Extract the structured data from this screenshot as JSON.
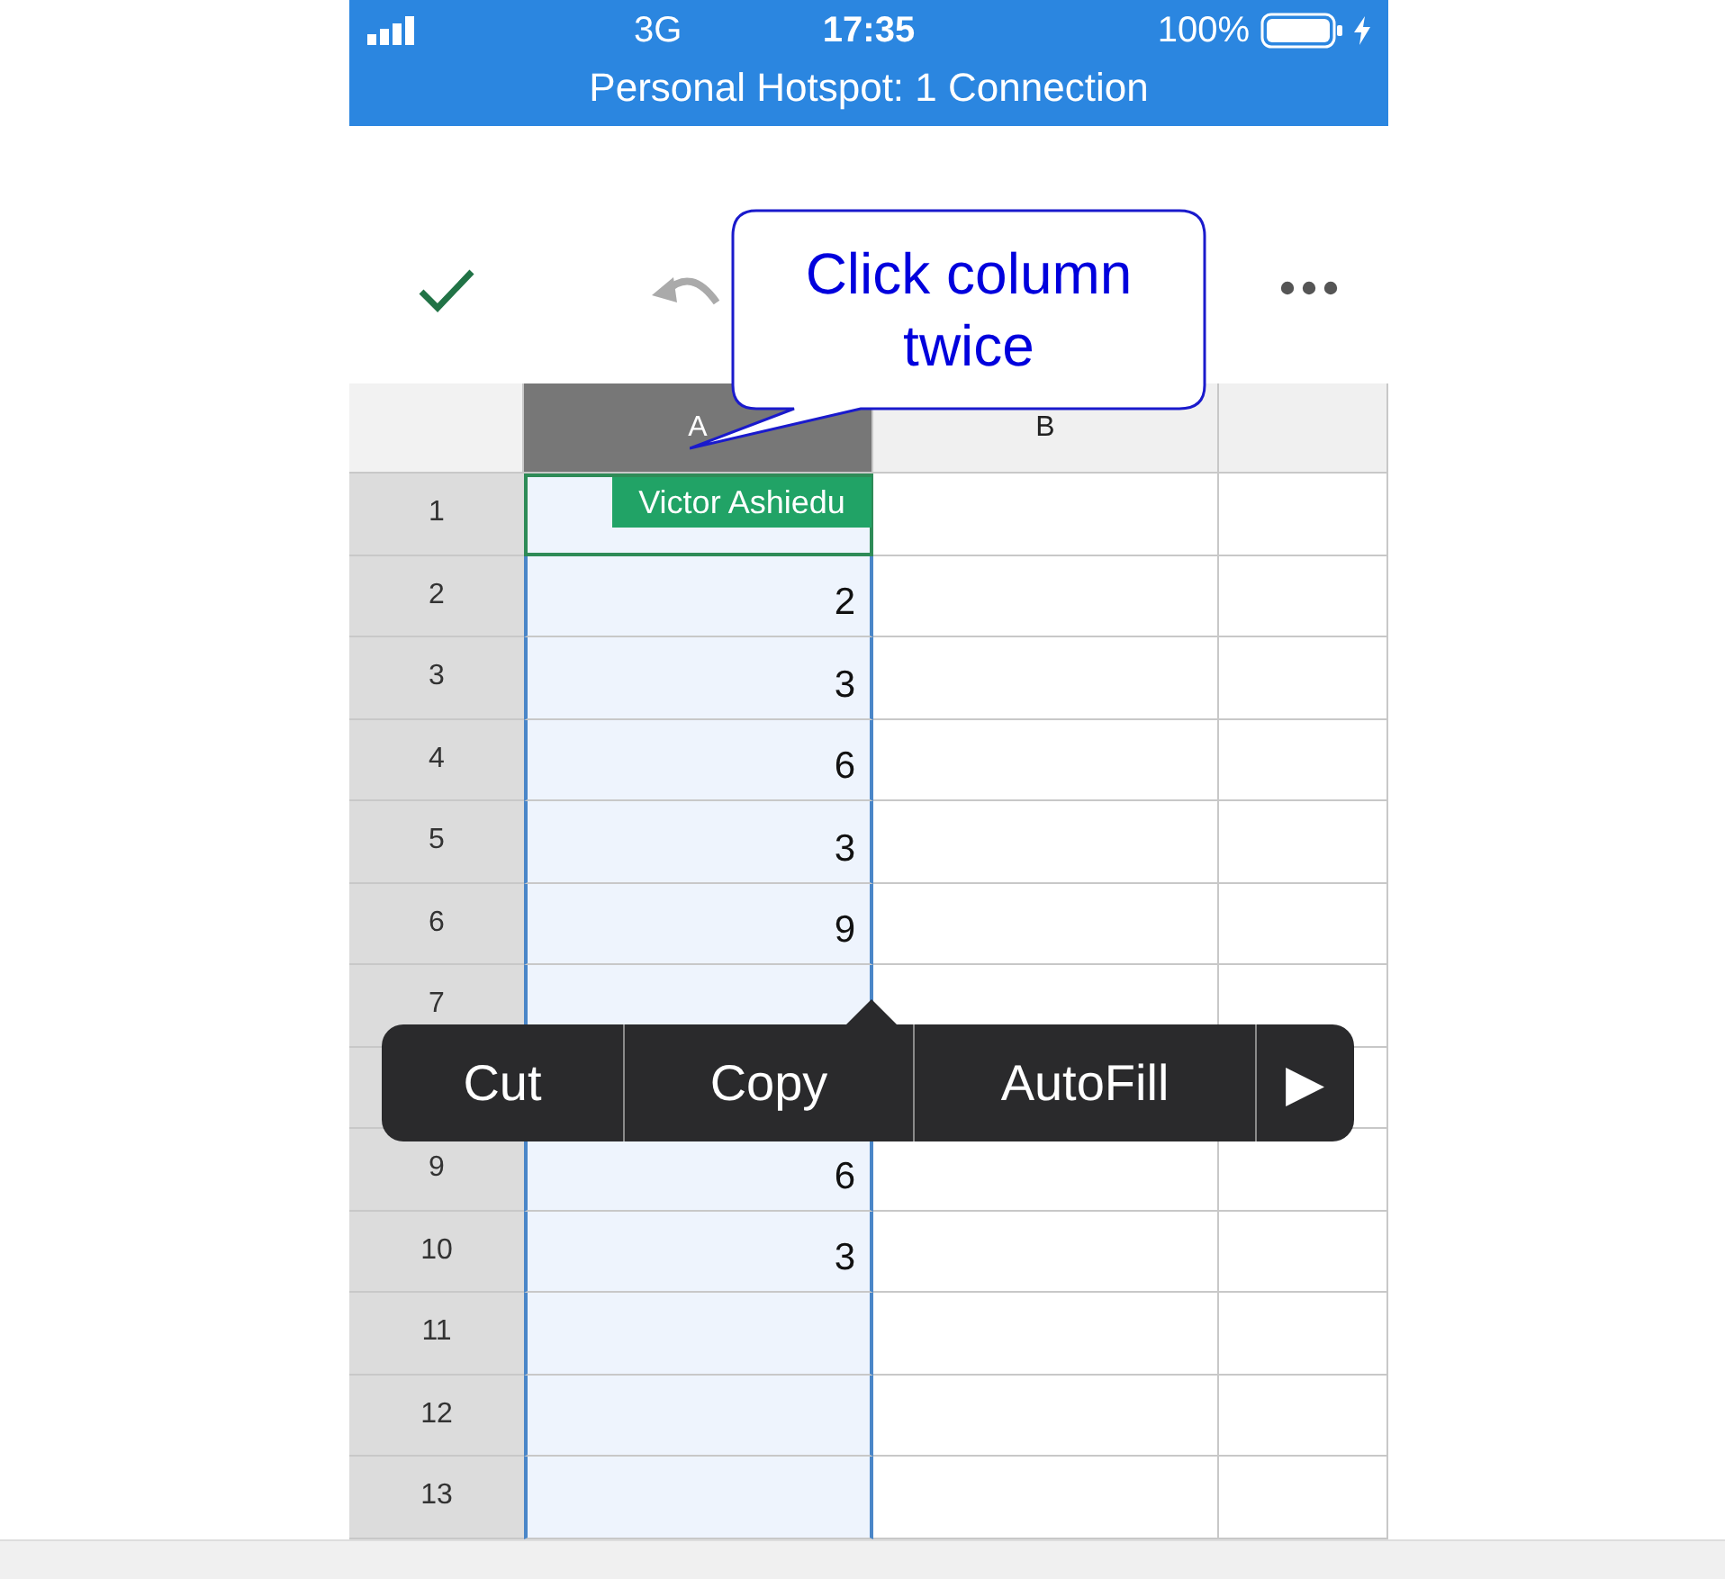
{
  "status_bar": {
    "network": "3G",
    "time": "17:35",
    "battery": "100%",
    "banner": "Personal Hotspot: 1 Connection"
  },
  "callout": {
    "text": "Click column twice"
  },
  "name_tag": {
    "text": "Victor Ashiedu"
  },
  "columns": [
    {
      "label": "A",
      "selected": true
    },
    {
      "label": "B",
      "selected": false
    }
  ],
  "rows": [
    {
      "label": "1",
      "active": true
    },
    {
      "label": "2",
      "value": "2",
      "active": false
    },
    {
      "label": "3",
      "value": "3",
      "active": false
    },
    {
      "label": "4",
      "value": "6",
      "active": false
    },
    {
      "label": "5",
      "value": "3",
      "active": false
    },
    {
      "label": "6",
      "value": "9",
      "active": false
    },
    {
      "label": "7",
      "active": false
    },
    {},
    {
      "label": "9",
      "value": "6",
      "active": false
    },
    {
      "label": "10",
      "value": "3",
      "active": false
    },
    {
      "label": "11",
      "active": false
    },
    {
      "label": "12",
      "active": false
    },
    {
      "label": "13",
      "active": false
    }
  ],
  "context_menu": [
    {
      "label": "Cut",
      "kind": "action"
    },
    {
      "label": "Copy",
      "kind": "action"
    },
    {
      "label": "AutoFill",
      "kind": "action"
    },
    {
      "label": "▶",
      "kind": "more"
    }
  ]
}
